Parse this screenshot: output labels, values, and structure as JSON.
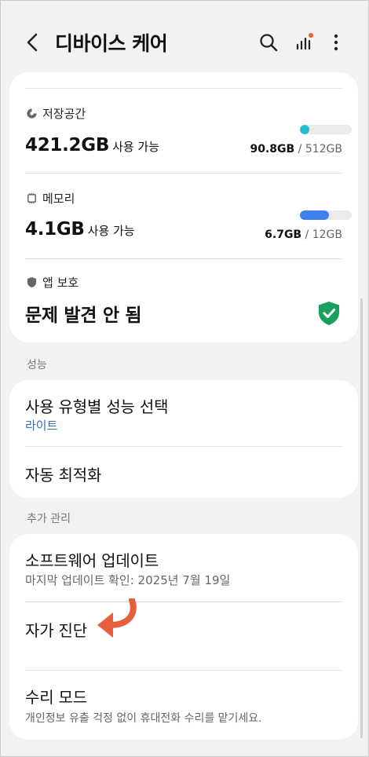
{
  "header": {
    "title": "디바이스 케어",
    "icons": [
      "back-icon",
      "search-icon",
      "stats-icon",
      "more-icon"
    ]
  },
  "storage": {
    "label": "저장공간",
    "available": "421.2GB",
    "available_suffix": "사용 가능",
    "used": "90.8GB",
    "total": " / 512GB",
    "used_fraction": 0.18,
    "bar_color": "#1fbfcf"
  },
  "memory": {
    "label": "메모리",
    "available": "4.1GB",
    "available_suffix": "사용 가능",
    "used": "6.7GB",
    "total": " / 12GB",
    "used_fraction": 0.56,
    "bar_color": "#3d82f0"
  },
  "app_protection": {
    "label": "앱 보호",
    "status": "문제 발견 안 됨",
    "status_color": "#1aa05a"
  },
  "performance_section": {
    "header": "성능",
    "items": [
      {
        "title": "사용 유형별 성능 선택",
        "subtitle": "라이트"
      },
      {
        "title": "자동 최적화"
      }
    ]
  },
  "extra_section": {
    "header": "추가 관리",
    "items": [
      {
        "title": "소프트웨어 업데이트",
        "subtitle": "마지막 업데이트 확인: 2025년 7월 19일"
      },
      {
        "title": "자가 진단"
      },
      {
        "title": "수리 모드",
        "subtitle": "개인정보 유출 걱정 없이 휴대전화 수리를 맡기세요."
      }
    ]
  },
  "colors": {
    "accent_blue": "#3b6fb3",
    "arrow": "#e5603a",
    "badge": "#e8622c"
  }
}
